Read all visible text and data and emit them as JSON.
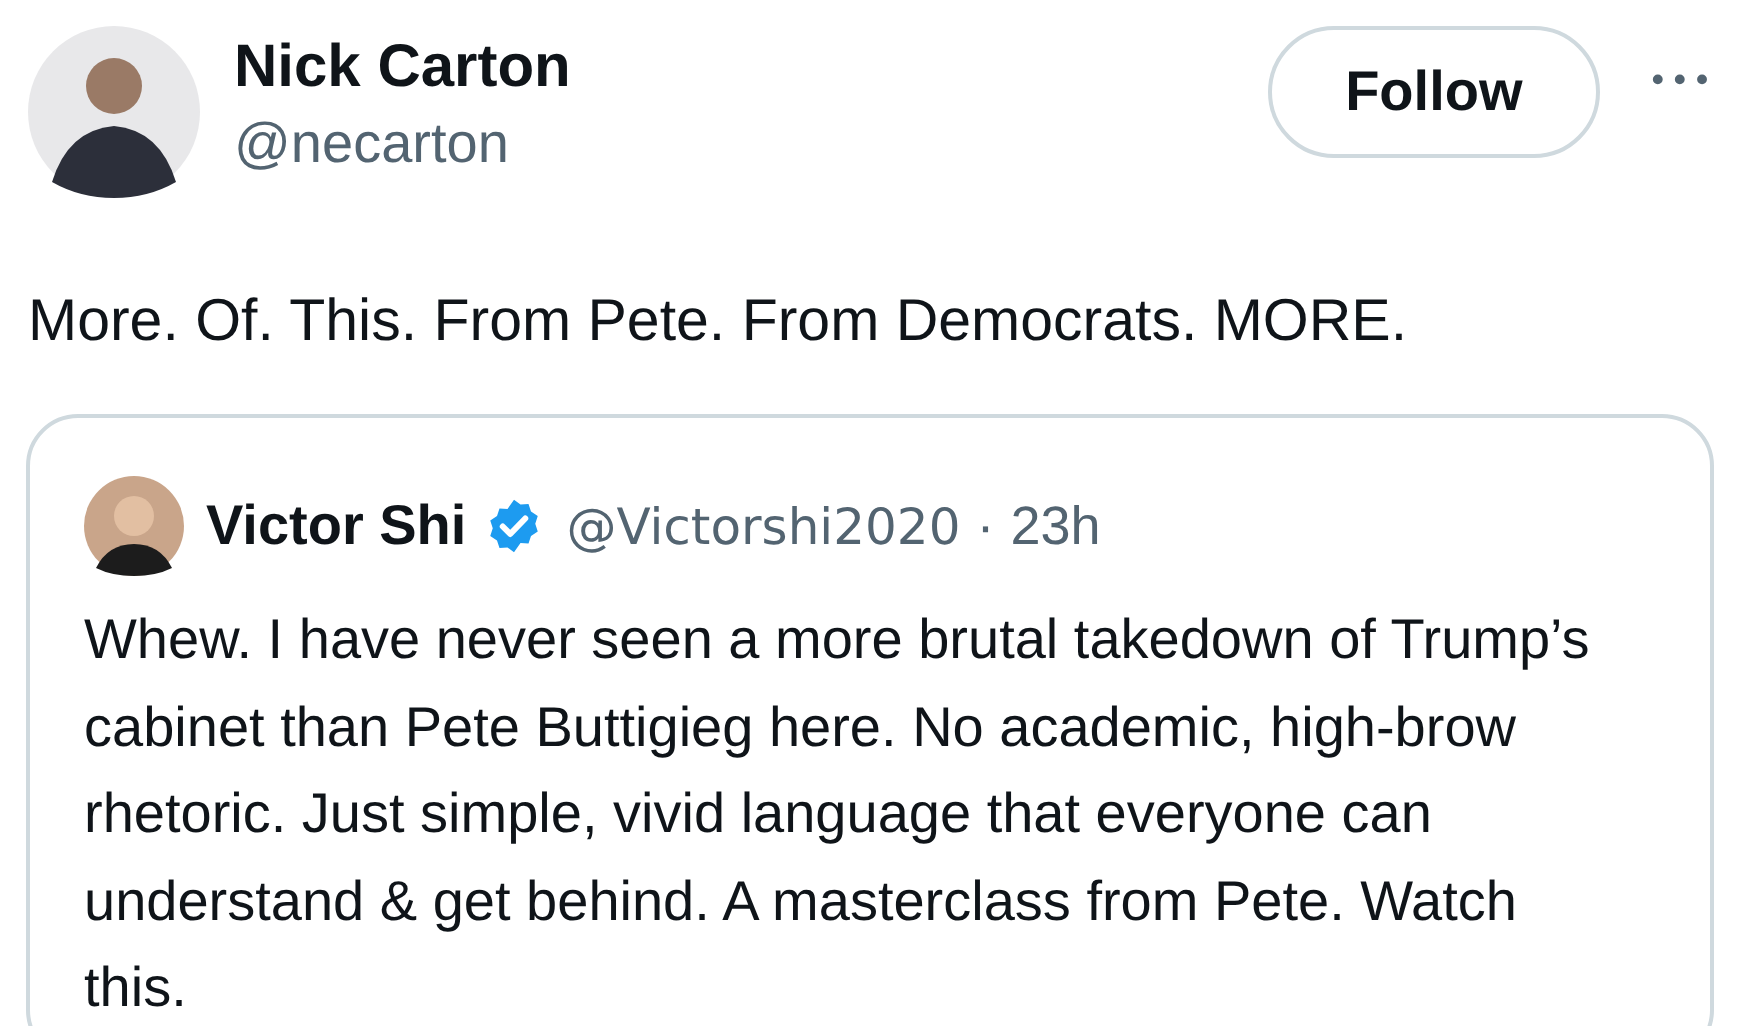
{
  "author": {
    "name": "Nick Carton",
    "handle": "@necarton"
  },
  "follow_button": "Follow",
  "more_button": "•••",
  "text": "More. Of. This. From Pete. From Democrats. MORE.",
  "quote": {
    "name": "Victor Shi",
    "verified": true,
    "handle": "@Victorshi2020",
    "separator": "·",
    "time": "23h",
    "text": "Whew. I have never seen a more brutal takedown of Trump’s cabinet than Pete Buttigieg here. No academic, high-brow rhetoric. Just simple, vivid language that everyone can understand & get behind. A masterclass from Pete. Watch this."
  }
}
